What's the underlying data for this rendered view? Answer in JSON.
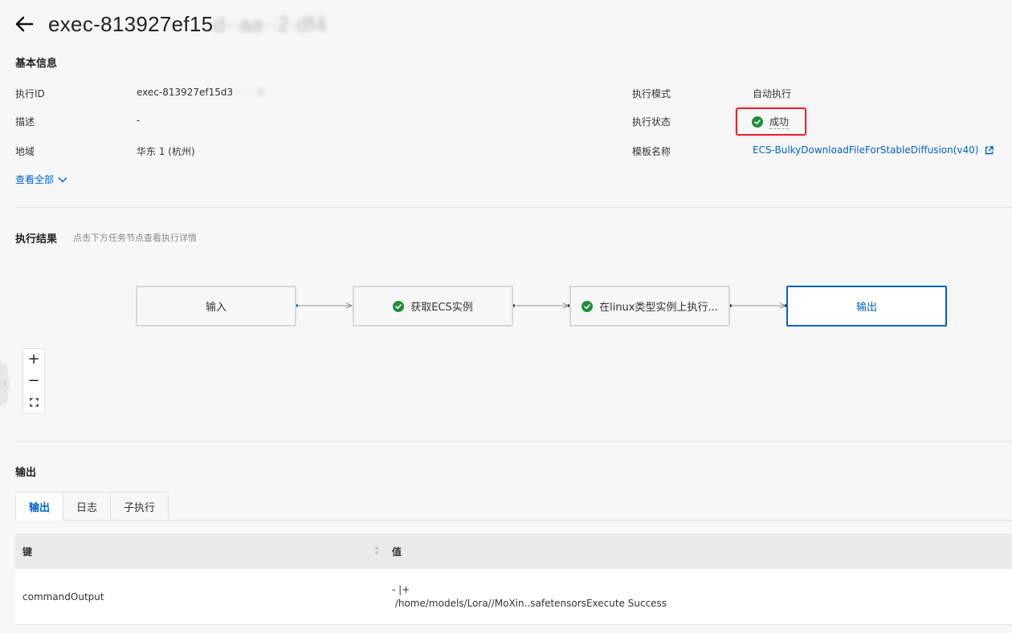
{
  "header": {
    "title_visible": "exec-813927ef15",
    "title_obscured": "d··aa··2·df4"
  },
  "basic_info": {
    "section_title": "基本信息",
    "exec_id_label": "执行ID",
    "exec_id_value": "exec-813927ef15d3",
    "exec_id_obscured": "········4",
    "desc_label": "描述",
    "desc_value": "-",
    "region_label": "地域",
    "region_value": "华东 1 (杭州)",
    "mode_label": "执行模式",
    "mode_value": "自动执行",
    "status_label": "执行状态",
    "status_value": "成功",
    "template_label": "模板名称",
    "template_value": "ECS-BulkyDownloadFileForStableDiffusion(v40)",
    "view_all": "查看全部"
  },
  "result": {
    "section_title": "执行结果",
    "hint": "点击下方任务节点查看执行详情",
    "nodes": [
      {
        "label": "输入",
        "status": "none"
      },
      {
        "label": "获取ECS实例",
        "status": "success"
      },
      {
        "label": "在linux类型实例上执行...",
        "status": "success"
      },
      {
        "label": "输出",
        "status": "active"
      }
    ]
  },
  "zoom": {
    "in": "+",
    "out": "−"
  },
  "output": {
    "section_title": "输出",
    "tabs": [
      "输出",
      "日志",
      "子执行"
    ],
    "active_tab": 0,
    "columns": [
      "键",
      "值"
    ],
    "rows": [
      {
        "key": "commandOutput",
        "value_line1": "- |+",
        "value_line2": " /home/models/Lora//MoXin..safetensorsExecute Success"
      }
    ]
  },
  "colors": {
    "accent": "#0064c8",
    "success": "#1e8e3e",
    "highlight_border": "#e0262f"
  }
}
